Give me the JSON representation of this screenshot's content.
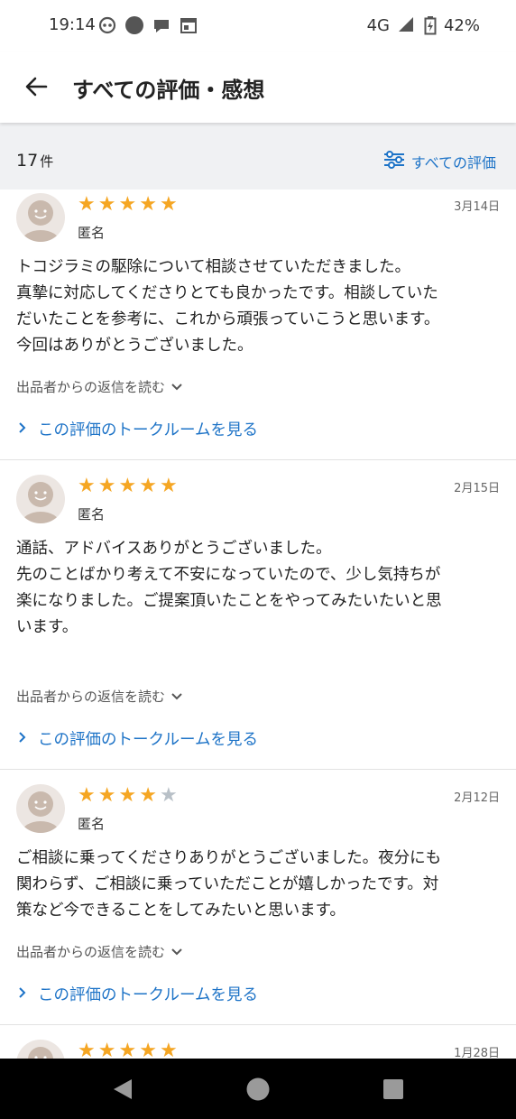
{
  "status_bar": {
    "time": "19:14",
    "network": "4G",
    "battery": "42%",
    "icons": [
      "assistant-icon",
      "circle-icon",
      "chat-bubble-icon",
      "calendar-icon",
      "signal-icon",
      "battery-icon"
    ]
  },
  "app_bar": {
    "title": "すべての評価・感想",
    "back_icon": "arrow-left-icon"
  },
  "sub_header": {
    "count": "17",
    "count_unit": "件",
    "filter_label": "すべての評価",
    "filter_icon": "sliders-icon"
  },
  "reviews": [
    {
      "rating": 5,
      "reviewer": "匿名",
      "date": "3月14日",
      "text": "トコジラミの駆除について相談させていただきました。\n真摯に対応してくださりとても良かったです。相談していた\nだいたことを参考に、これから頑張っていこうと思います。\n今回はありがとうございました。",
      "reply_label": "出品者からの返信を読む",
      "talk_label": "この評価のトークルームを見る"
    },
    {
      "rating": 5,
      "reviewer": "匿名",
      "date": "2月15日",
      "text": "通話、アドバイスありがとうございました。\n先のことばかり考えて不安になっていたので、少し気持ちが\n楽になりました。ご提案頂いたことをやってみたいたいと思\nいます。",
      "reply_label": "出品者からの返信を読む",
      "talk_label": "この評価のトークルームを見る"
    },
    {
      "rating": 4,
      "reviewer": "匿名",
      "date": "2月12日",
      "text": "ご相談に乗ってくださりありがとうございました。夜分にも\n関わらず、ご相談に乗っていただことが嬉しかったです。対\n策など今できることをしてみたいと思います。",
      "reply_label": "出品者からの返信を読む",
      "talk_label": "この評価のトークルームを見る"
    },
    {
      "rating": 5,
      "reviewer": "",
      "date": "1月28日",
      "text": "",
      "reply_label": "",
      "talk_label": ""
    }
  ],
  "colors": {
    "star_on": "#f5a623",
    "star_off": "#b8c0c7",
    "link": "#1d73c7",
    "header_bg": "#f0f1f3"
  },
  "nav_bar": {
    "icons": [
      "back-triangle-icon",
      "home-circle-icon",
      "recents-square-icon"
    ]
  }
}
